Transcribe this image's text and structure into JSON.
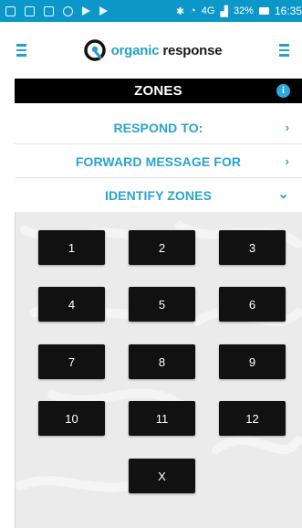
{
  "status_bar": {
    "network": "4G",
    "battery": "32%",
    "time": "16:35",
    "background_color": "#0b98c9"
  },
  "header": {
    "brand_prefix": "organic",
    "brand_suffix": "response",
    "left_menu_icon": "hamburger-icon",
    "right_menu_icon": "hamburger-icon",
    "accent_color": "#25a0c8"
  },
  "zones_bar": {
    "title": "ZONES",
    "info_icon_glyph": "i"
  },
  "menu": [
    {
      "label": "RESPOND TO:",
      "chevron": "›",
      "state": "collapsed"
    },
    {
      "label": "FORWARD MESSAGE FOR",
      "chevron": "›",
      "state": "collapsed"
    },
    {
      "label": "IDENTIFY ZONES",
      "chevron": "⌄",
      "state": "expanded"
    }
  ],
  "zone_buttons": [
    "1",
    "2",
    "3",
    "4",
    "5",
    "6",
    "7",
    "8",
    "9",
    "10",
    "11",
    "12",
    "X"
  ]
}
